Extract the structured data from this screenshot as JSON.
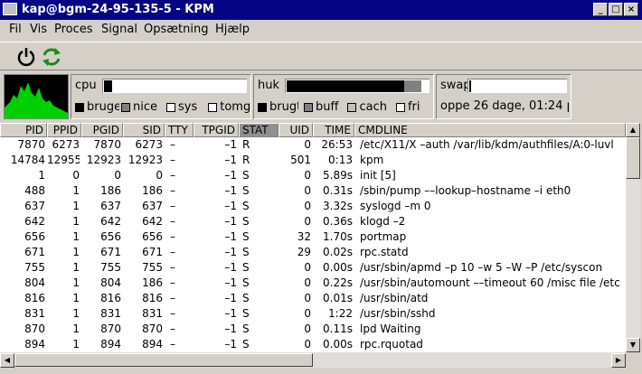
{
  "window": {
    "title": "kap@bgm-24-95-135-5 - KPM",
    "minimize": "_",
    "maximize": "□",
    "close": "×"
  },
  "menu": [
    "Fil",
    "Vis",
    "Proces",
    "Signal",
    "Opsætning",
    "Hjælp"
  ],
  "cpu": {
    "label": "cpu",
    "used": 0.06,
    "legend": [
      "bruger",
      "nice",
      "sys",
      "tomg"
    ],
    "colors": [
      "#000000",
      "#808080",
      "#ffffff",
      "#ffffff"
    ]
  },
  "mem": {
    "label": "huk",
    "used": 0.82,
    "buff": 0.12,
    "legend": [
      "brugt",
      "buff",
      "cach",
      "fri"
    ]
  },
  "swap": {
    "label": "swap",
    "used": 0.02
  },
  "uptime": "oppe 26 dage, 01:24 p",
  "columns": [
    "PID",
    "PPID",
    "PGID",
    "SID",
    "TTY",
    "TPGID",
    "STAT",
    "UID",
    "TIME",
    "CMDLINE"
  ],
  "processes": [
    [
      "7870",
      "6273",
      "7870",
      "6273",
      "–",
      "–1",
      "R",
      "0",
      "26:53",
      "/etc/X11/X –auth /var/lib/kdm/authfiles/A:0-luvl"
    ],
    [
      "14784",
      "12955",
      "12923",
      "12923",
      "–",
      "–1",
      "R",
      "501",
      "0:13",
      "kpm"
    ],
    [
      "1",
      "0",
      "0",
      "0",
      "–",
      "–1",
      "S",
      "0",
      "5.89s",
      "init [5]"
    ],
    [
      "488",
      "1",
      "186",
      "186",
      "–",
      "–1",
      "S",
      "0",
      "0.31s",
      "/sbin/pump ––lookup–hostname –i eth0"
    ],
    [
      "637",
      "1",
      "637",
      "637",
      "–",
      "–1",
      "S",
      "0",
      "3.32s",
      "syslogd –m 0"
    ],
    [
      "642",
      "1",
      "642",
      "642",
      "–",
      "–1",
      "S",
      "0",
      "0.36s",
      "klogd –2"
    ],
    [
      "656",
      "1",
      "656",
      "656",
      "–",
      "–1",
      "S",
      "32",
      "1.70s",
      "portmap"
    ],
    [
      "671",
      "1",
      "671",
      "671",
      "–",
      "–1",
      "S",
      "29",
      "0.02s",
      "rpc.statd"
    ],
    [
      "755",
      "1",
      "755",
      "755",
      "–",
      "–1",
      "S",
      "0",
      "0.00s",
      "/usr/sbin/apmd –p 10 –w 5 –W –P /etc/syscon"
    ],
    [
      "804",
      "1",
      "804",
      "186",
      "–",
      "–1",
      "S",
      "0",
      "0.22s",
      "/usr/sbin/automount ––timeout 60 /misc file /etc"
    ],
    [
      "816",
      "1",
      "816",
      "816",
      "–",
      "–1",
      "S",
      "0",
      "0.01s",
      "/usr/sbin/atd"
    ],
    [
      "831",
      "1",
      "831",
      "831",
      "–",
      "–1",
      "S",
      "0",
      "1:22",
      "/usr/sbin/sshd"
    ],
    [
      "870",
      "1",
      "870",
      "870",
      "–",
      "–1",
      "S",
      "0",
      "0.11s",
      "lpd Waiting"
    ],
    [
      "894",
      "1",
      "894",
      "894",
      "–",
      "–1",
      "S",
      "0",
      "0.00s",
      "rpc.rquotad"
    ]
  ]
}
